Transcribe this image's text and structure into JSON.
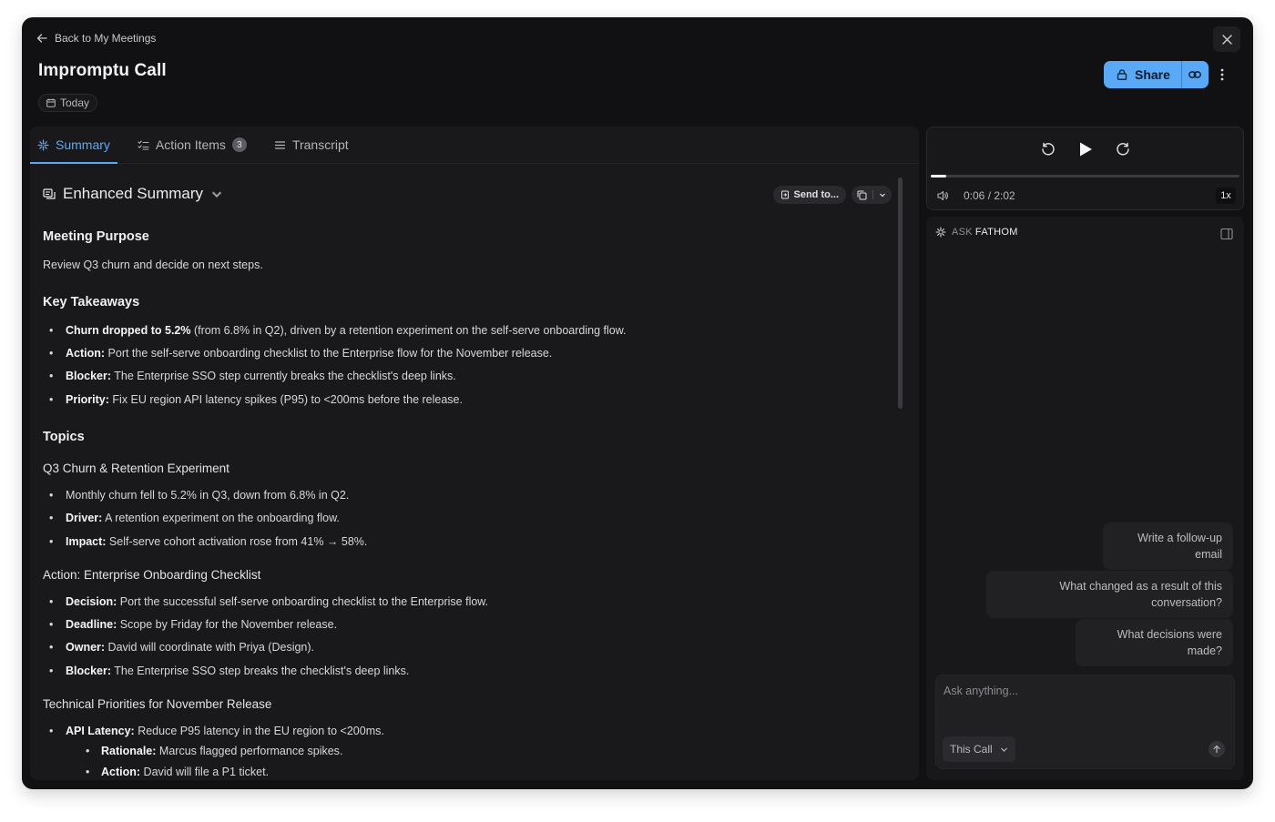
{
  "header": {
    "back_label": "Back to My Meetings",
    "title": "Impromptu Call",
    "date_chip": "Today",
    "share_label": "Share"
  },
  "tabs": [
    {
      "label": "Summary",
      "active": true
    },
    {
      "label": "Action Items",
      "badge": "3"
    },
    {
      "label": "Transcript"
    }
  ],
  "summary": {
    "heading": "Enhanced Summary",
    "send_to_label": "Send to...",
    "sections": {
      "purpose_title": "Meeting Purpose",
      "purpose_text": "Review Q3 churn and decide on next steps.",
      "takeaways_title": "Key Takeaways",
      "takeaways": [
        {
          "bold": "Churn dropped to 5.2%",
          "text": " (from 6.8% in Q2), driven by a retention experiment on the self-serve onboarding flow."
        },
        {
          "bold": "Action:",
          "text": " Port the self-serve onboarding checklist to the Enterprise flow for the November release."
        },
        {
          "bold": "Blocker:",
          "text": " The Enterprise SSO step currently breaks the checklist's deep links."
        },
        {
          "bold": "Priority:",
          "text": " Fix EU region API latency spikes (P95) to <200ms before the release."
        }
      ],
      "topics_title": "Topics",
      "topic1_title": "Q3 Churn & Retention Experiment",
      "topic1": [
        {
          "bold": "",
          "text": "Monthly churn fell to 5.2% in Q3, down from 6.8% in Q2."
        },
        {
          "bold": "Driver:",
          "text": " A retention experiment on the onboarding flow."
        },
        {
          "bold": "Impact:",
          "text": " Self-serve cohort activation rose from 41% → 58%."
        }
      ],
      "topic2_title": "Action: Enterprise Onboarding Checklist",
      "topic2": [
        {
          "bold": "Decision:",
          "text": " Port the successful self-serve onboarding checklist to the Enterprise flow."
        },
        {
          "bold": "Deadline:",
          "text": " Scope by Friday for the November release."
        },
        {
          "bold": "Owner:",
          "text": " David will coordinate with Priya (Design)."
        },
        {
          "bold": "Blocker:",
          "text": " The Enterprise SSO step breaks the checklist's deep links."
        }
      ],
      "topic3_title": "Technical Priorities for November Release",
      "topic3": [
        {
          "bold": "API Latency:",
          "text": " Reduce P95 latency in the EU region to <200ms."
        },
        {
          "bold": "Rationale:",
          "text": " Marcus flagged performance spikes."
        },
        {
          "bold": "Action:",
          "text": " David will file a P1 ticket."
        }
      ]
    }
  },
  "player": {
    "time": "0:06 / 2:02",
    "speed": "1x",
    "progress": 0.049
  },
  "ask": {
    "label_prefix": "ASK",
    "label_brand": "FATHOM",
    "suggestions": [
      "Write a follow-up email",
      "What changed as a result of this conversation?",
      "What decisions were made?"
    ],
    "placeholder": "Ask anything...",
    "scope": "This Call"
  },
  "colors": {
    "accent": "#5aa9f7",
    "background": "#111113",
    "panel": "#19191c"
  }
}
